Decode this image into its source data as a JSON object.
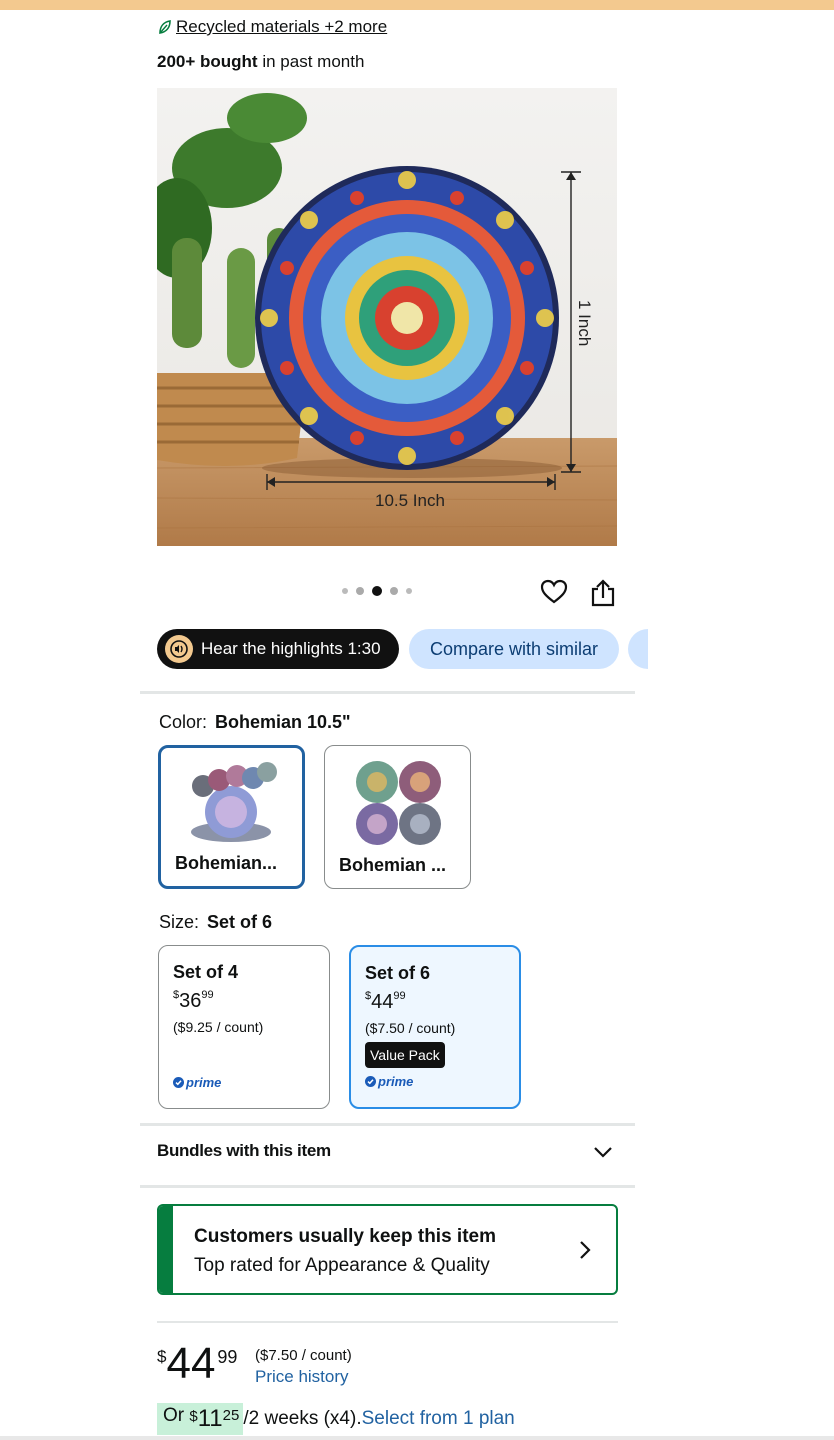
{
  "badges": {
    "sustainability": "Recycled materials +2 more",
    "bought_strong": "200+ bought",
    "bought_rest": "in past month"
  },
  "image": {
    "height_label": "1 Inch",
    "width_label": "10.5 Inch",
    "carousel_count": 5,
    "carousel_active": 3
  },
  "actions": {
    "hear_highlights": "Hear the highlights 1:30",
    "compare": "Compare with similar"
  },
  "color": {
    "label": "Color:",
    "selected": "Bohemian 10.5\"",
    "options": [
      "Bohemian...",
      "Bohemian ..."
    ]
  },
  "size": {
    "label": "Size:",
    "selected": "Set of 6",
    "options": [
      {
        "name": "Set of 4",
        "currency": "$",
        "whole": "36",
        "fraction": "99",
        "unit": "($9.25 / count)",
        "prime": "prime"
      },
      {
        "name": "Set of 6",
        "currency": "$",
        "whole": "44",
        "fraction": "99",
        "unit": "($7.50 / count)",
        "badge": "Value Pack",
        "prime": "prime"
      }
    ]
  },
  "bundles": {
    "label": "Bundles with this item"
  },
  "keep": {
    "title": "Customers usually keep this item",
    "subtitle": "Top rated for Appearance & Quality"
  },
  "price": {
    "currency": "$",
    "whole": "44",
    "fraction": "99",
    "per_unit": "($7.50 / count)",
    "history": "Price history"
  },
  "installment": {
    "prefix": "Or",
    "currency": "$",
    "whole": "11",
    "fraction": "25",
    "terms": "/2 weeks (x4).",
    "plan_link": "Select from 1 plan"
  },
  "colors": {
    "accent_blue": "#2162a1",
    "keep_green": "#067d3f",
    "compare_bg": "#cfe4ff",
    "top_strip": "#f3c98f"
  }
}
